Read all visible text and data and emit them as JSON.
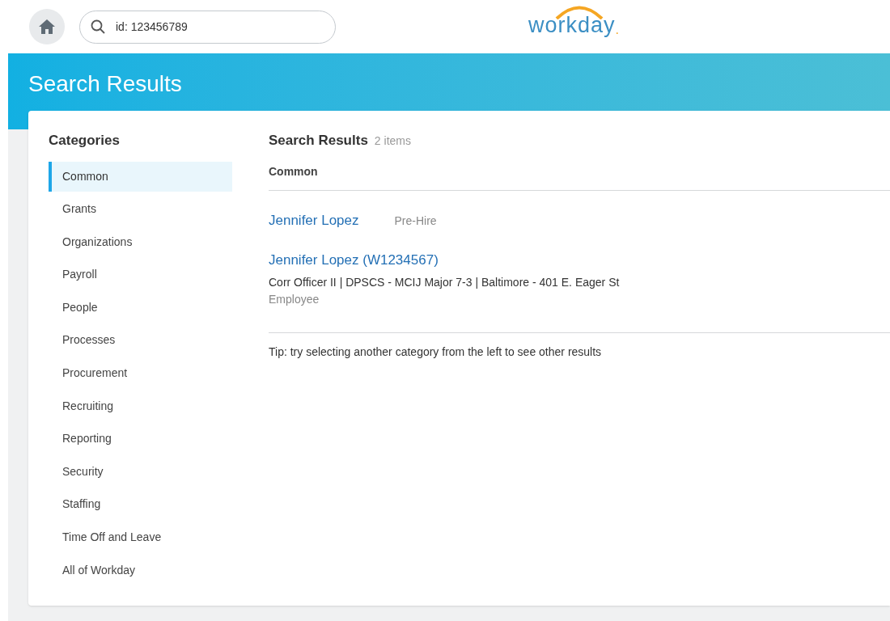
{
  "search": {
    "value": "id: 123456789"
  },
  "logo": {
    "text": "workday",
    "mark": "."
  },
  "page_title": "Search Results",
  "categories": {
    "title": "Categories",
    "items": [
      {
        "label": "Common",
        "selected": true
      },
      {
        "label": "Grants",
        "selected": false
      },
      {
        "label": "Organizations",
        "selected": false
      },
      {
        "label": "Payroll",
        "selected": false
      },
      {
        "label": "People",
        "selected": false
      },
      {
        "label": "Processes",
        "selected": false
      },
      {
        "label": "Procurement",
        "selected": false
      },
      {
        "label": "Recruiting",
        "selected": false
      },
      {
        "label": "Reporting",
        "selected": false
      },
      {
        "label": "Security",
        "selected": false
      },
      {
        "label": "Staffing",
        "selected": false
      },
      {
        "label": "Time Off and Leave",
        "selected": false
      },
      {
        "label": "All of Workday",
        "selected": false
      }
    ]
  },
  "results": {
    "title": "Search Results",
    "count": "2 items",
    "section": "Common",
    "items": [
      {
        "name": "Jennifer Lopez",
        "tag": "Pre-Hire"
      },
      {
        "name": "Jennifer Lopez (W1234567)",
        "detail": "Corr Officer II | DPSCS - MCIJ Major 7-3 | Baltimore - 401 E. Eager St",
        "type": "Employee"
      }
    ],
    "tip": "Tip: try selecting another category from the left to see other results"
  }
}
